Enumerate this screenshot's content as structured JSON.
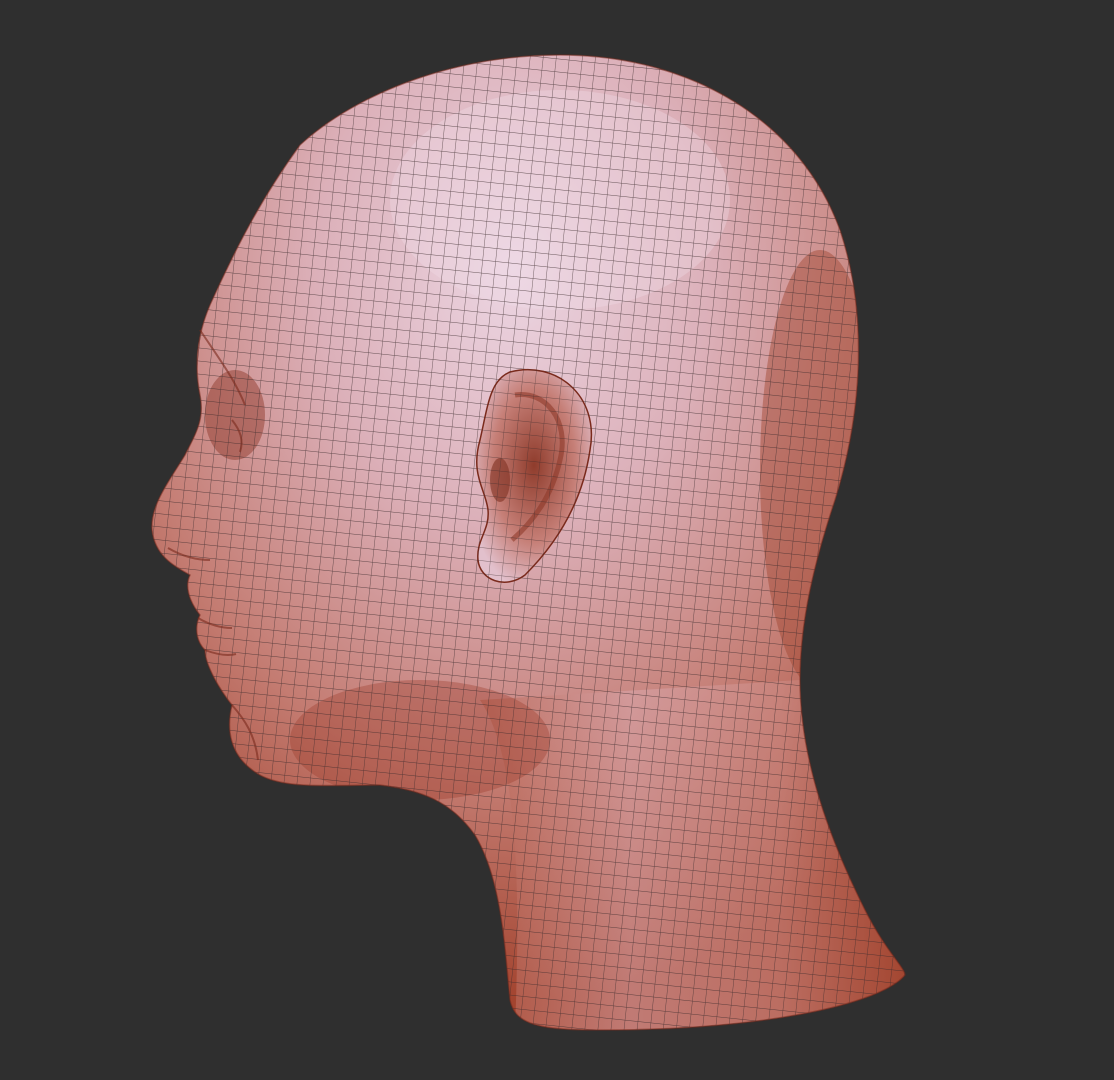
{
  "viewport": {
    "background": "#2f2f2f"
  },
  "model": {
    "subject": "head-sculpt",
    "view": "left-profile",
    "shading": "matcap-clay",
    "wireframe": true,
    "colors": {
      "skin_light": "#e6c8d6",
      "skin_mid": "#c98a80",
      "skin_dark": "#a84a36",
      "wire": "#3a2a2c"
    }
  }
}
